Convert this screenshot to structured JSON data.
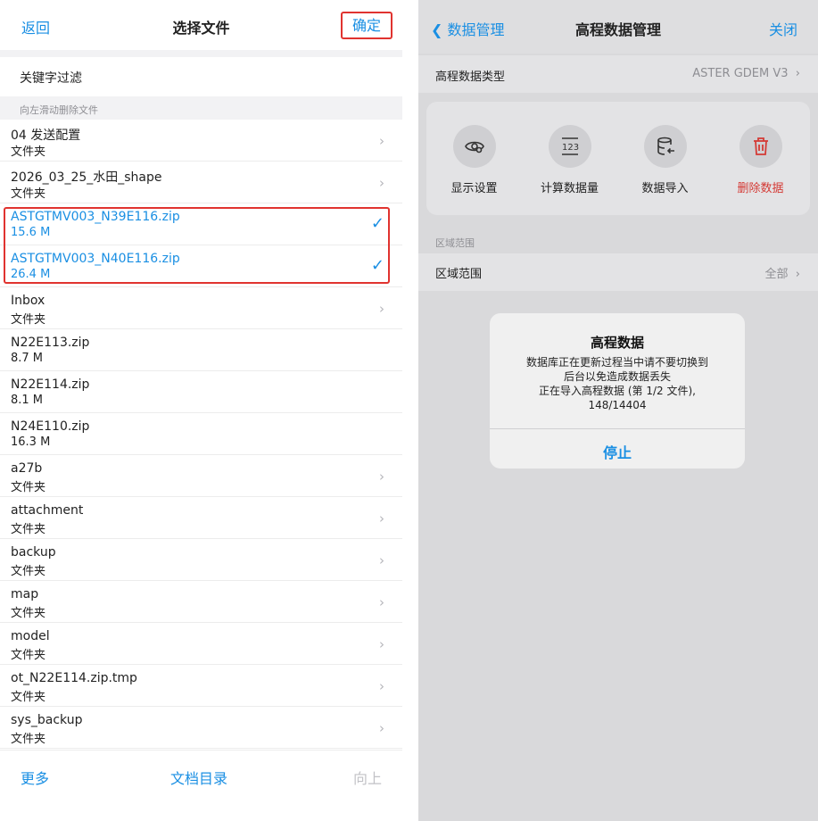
{
  "left": {
    "back": "返回",
    "title": "选择文件",
    "confirm": "确定",
    "filter_label": "关键字过滤",
    "hint": "向左滑动删除文件",
    "files": [
      {
        "name": "04 发送配置",
        "sub": "文件夹",
        "folder": true,
        "selected": false
      },
      {
        "name": "2026_03_25_水田_shape",
        "sub": "文件夹",
        "folder": true,
        "selected": false
      },
      {
        "name": "ASTGTMV003_N39E116.zip",
        "sub": "15.6 M",
        "folder": false,
        "selected": true
      },
      {
        "name": "ASTGTMV003_N40E116.zip",
        "sub": "26.4 M",
        "folder": false,
        "selected": true
      },
      {
        "name": "Inbox",
        "sub": "文件夹",
        "folder": true,
        "selected": false
      },
      {
        "name": "N22E113.zip",
        "sub": "8.7 M",
        "folder": false,
        "selected": false
      },
      {
        "name": "N22E114.zip",
        "sub": "8.1 M",
        "folder": false,
        "selected": false
      },
      {
        "name": "N24E110.zip",
        "sub": "16.3 M",
        "folder": false,
        "selected": false
      },
      {
        "name": "a27b",
        "sub": "文件夹",
        "folder": true,
        "selected": false
      },
      {
        "name": "attachment",
        "sub": "文件夹",
        "folder": true,
        "selected": false
      },
      {
        "name": "backup",
        "sub": "文件夹",
        "folder": true,
        "selected": false
      },
      {
        "name": "map",
        "sub": "文件夹",
        "folder": true,
        "selected": false
      },
      {
        "name": "model",
        "sub": "文件夹",
        "folder": true,
        "selected": false
      },
      {
        "name": "ot_N22E114.zip.tmp",
        "sub": "文件夹",
        "folder": true,
        "selected": false
      },
      {
        "name": "sys_backup",
        "sub": "文件夹",
        "folder": true,
        "selected": false
      }
    ],
    "bottom": {
      "more": "更多",
      "docs": "文档目录",
      "up": "向上"
    }
  },
  "right": {
    "back": "数据管理",
    "title": "高程数据管理",
    "close": "关闭",
    "type_label": "高程数据类型",
    "type_value": "ASTER GDEM V3",
    "actions": [
      {
        "label": "显示设置",
        "icon": "eye-settings-icon"
      },
      {
        "label": "计算数据量",
        "icon": "number-123-icon"
      },
      {
        "label": "数据导入",
        "icon": "database-import-icon"
      },
      {
        "label": "删除数据",
        "icon": "trash-icon"
      }
    ],
    "section_label": "区域范围",
    "region_label": "区域范围",
    "region_value": "全部",
    "alert": {
      "title": "高程数据",
      "line1": "数据库正在更新过程当中请不要切换到",
      "line2": "后台以免造成数据丢失",
      "line3": "正在导入高程数据 (第 1/2 文件),",
      "line4": "148/14404",
      "button": "停止"
    }
  },
  "colors": {
    "accent": "#1a8fe3",
    "danger": "#d43a35",
    "highlight_border": "#e0332f"
  }
}
